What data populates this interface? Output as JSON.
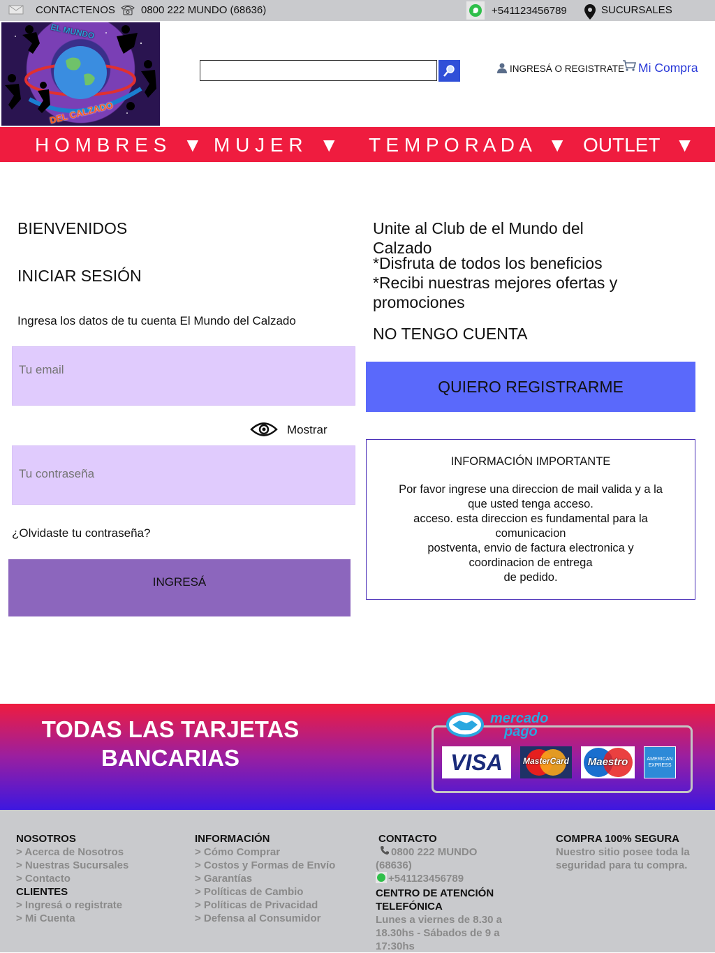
{
  "topbar": {
    "contact_label": "CONTACTENOS",
    "phone": "0800 222 MUNDO (68636)",
    "whatsapp": "+541123456789",
    "branches": "SUCURSALES"
  },
  "header": {
    "logo_top_text": "EL MUNDO",
    "logo_bottom_text": "DEL CALZADO",
    "search_placeholder": "",
    "login_link": "INGRESÁ O REGISTRATE",
    "cart_link": "Mi Compra"
  },
  "nav": {
    "items": [
      {
        "label": "H O M B R E S"
      },
      {
        "label": "M U J E R"
      },
      {
        "label": "T E M P O R A D A"
      },
      {
        "label": "OUTLET"
      }
    ],
    "arrow": "▼"
  },
  "login": {
    "welcome": "BIENVENIDOS",
    "title": "INICIAR SESIÓN",
    "subtitle": "Ingresa los datos de  tu cuenta El Mundo del Calzado",
    "email_placeholder": "Tu email",
    "show_label": "Mostrar",
    "password_placeholder": "Tu contraseña",
    "forgot": "¿Olvidaste tu contraseña?",
    "submit": "INGRESÁ"
  },
  "register": {
    "line1": "Unite al Club  de el Mundo del",
    "line2": "Calzado",
    "line3": "*Disfruta de todos los beneficios",
    "line4": "*Recibi nuestras mejores ofertas y",
    "line5": "promociones",
    "no_account": "NO TENGO CUENTA",
    "button": "QUIERO REGISTRARME"
  },
  "info": {
    "title": "INFORMACIÓN IMPORTANTE",
    "lines": [
      "Por favor ingrese una direccion de mail valida y a la",
      "que usted tenga acceso.",
      "acceso. esta direccion es fundamental para la",
      "comunicacion",
      "postventa, envio de factura electronica y",
      "coordinacion de entrega",
      "de pedido."
    ]
  },
  "promo": {
    "line1": "TODAS LAS TARJETAS",
    "line2": "BANCARIAS",
    "mp_line1": "mercado",
    "mp_line2": "pago",
    "cards": [
      "VISA",
      "MasterCard",
      "Maestro",
      "AMERICAN EXPRESS"
    ]
  },
  "footer": {
    "col1": {
      "title1": "NOSOTROS",
      "links1": [
        "> Acerca de Nosotros",
        "> Nuestras Sucursales",
        "> Contacto"
      ],
      "title2": "CLIENTES",
      "links2": [
        "> Ingresá o registrate",
        "> Mi Cuenta"
      ]
    },
    "col2": {
      "title": "INFORMACIÓN",
      "links": [
        "> Cómo Comprar",
        "> Costos y Formas de Envío",
        "> Garantías",
        "> Políticas de Cambio",
        "> Políticas de Privacidad",
        "> Defensa al Consumidor"
      ]
    },
    "col3": {
      "title": "CONTACTO",
      "phone1": "0800 222 MUNDO",
      "phone2": "(68636)",
      "whatsapp": "+541123456789",
      "center1": "CENTRO DE ATENCIÓN",
      "center2": "TELEFÓNICA",
      "hours1": "Lunes a viernes de 8.30 a",
      "hours2": "18.30hs - Sábados de 9 a",
      "hours3": "17:30hs"
    },
    "col4": {
      "title": "COMPRA 100% SEGURA",
      "text1": "Nuestro sitio posee toda la",
      "text2": "seguridad para tu compra."
    }
  },
  "colors": {
    "nav": "#ef1c3f",
    "field": "#e0cbfd",
    "login_button": "#8c66bd",
    "register_button": "#5a69fb",
    "info_border": "#4a2fb8"
  }
}
